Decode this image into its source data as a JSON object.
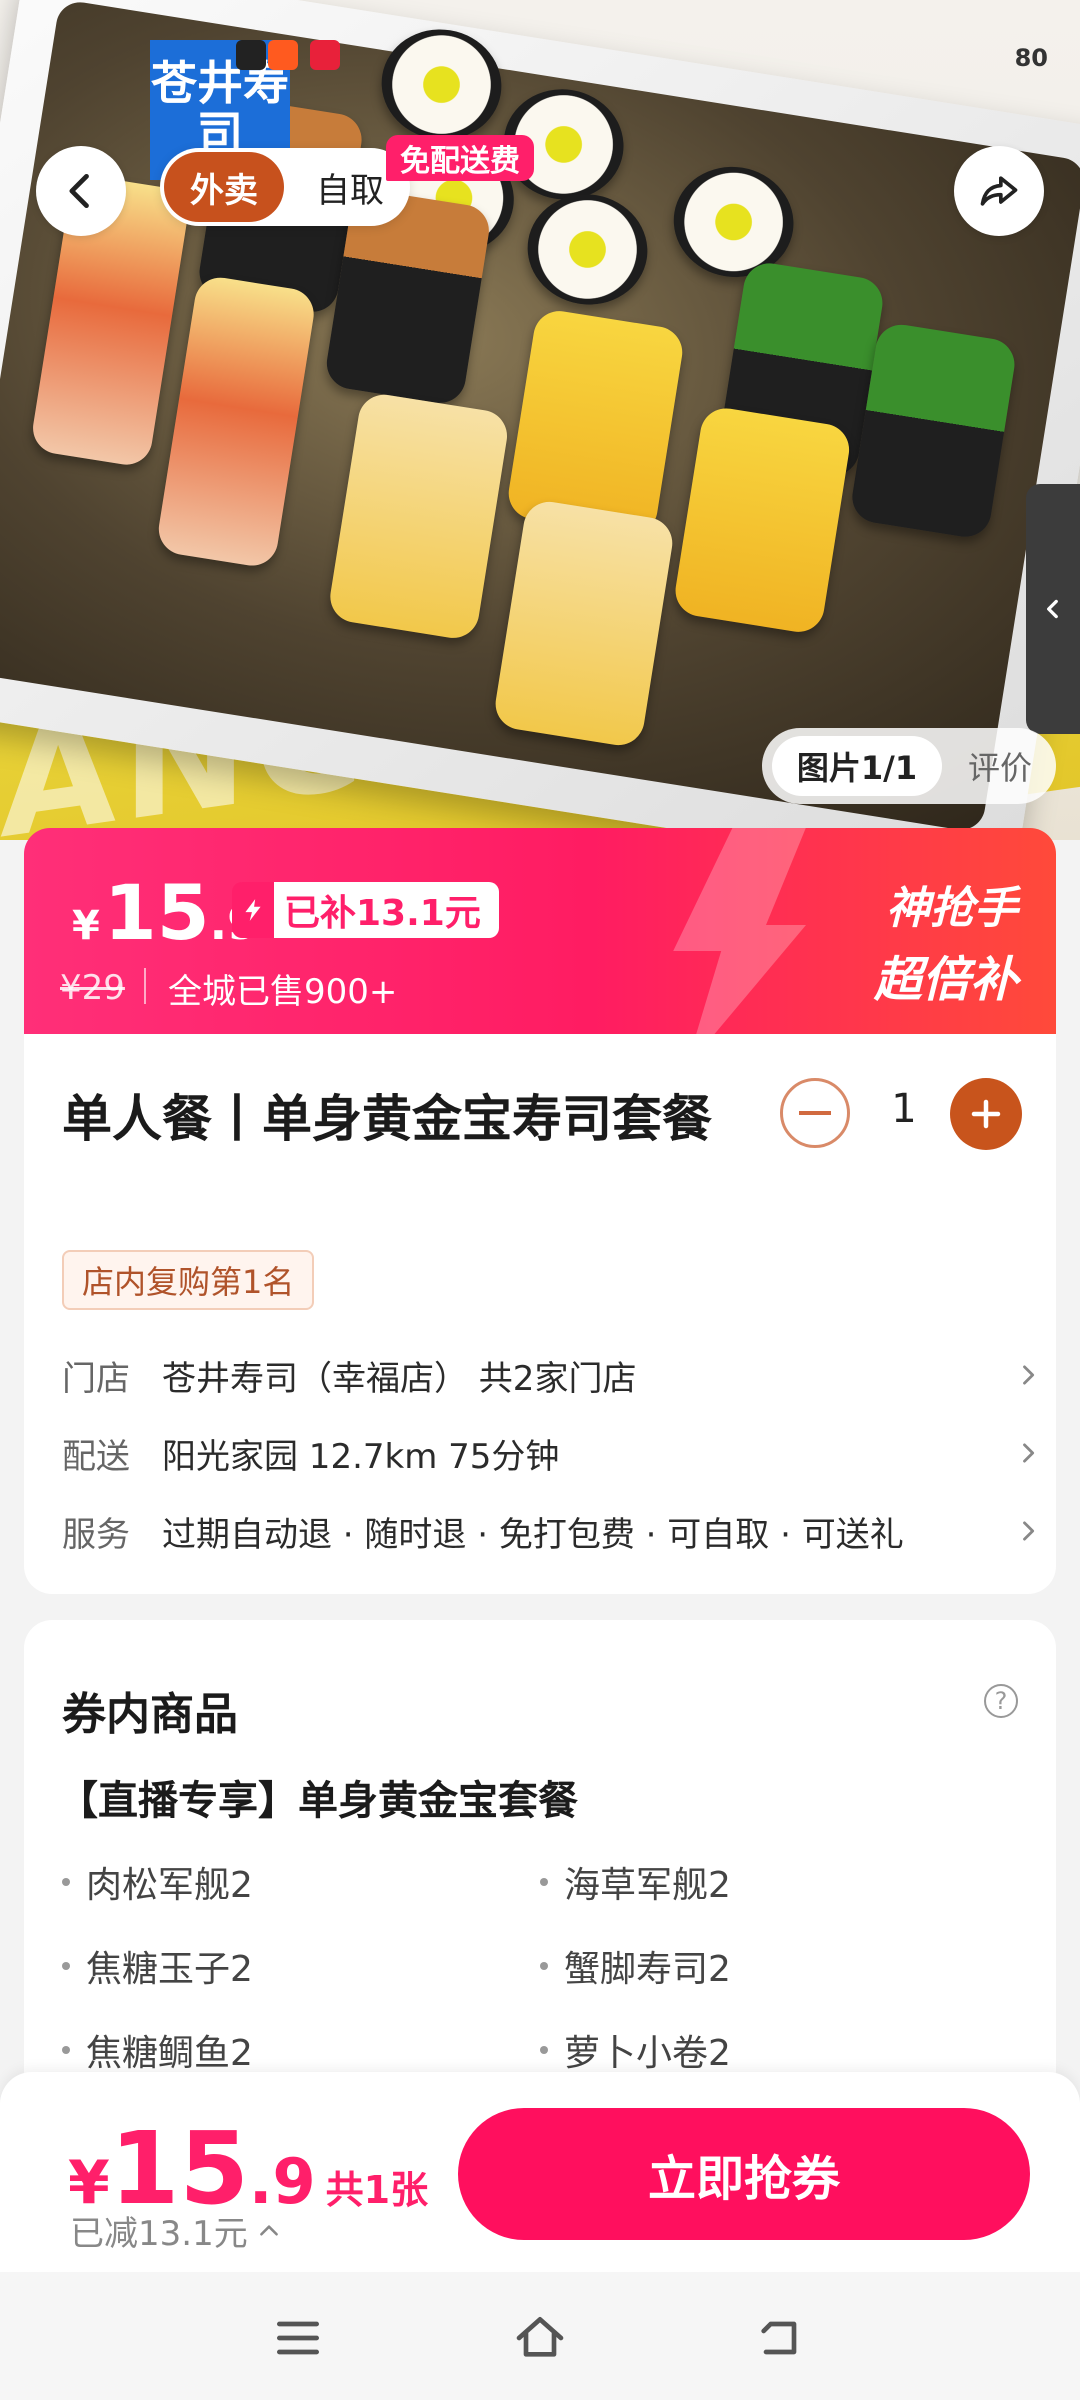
{
  "status": {
    "battery": "80"
  },
  "hero": {
    "logo_text": "苍井寿司",
    "mode_active": "外卖",
    "mode_inactive": "自取",
    "free_delivery_badge": "免配送费",
    "image_tab_active": "图片1/1",
    "image_tab_review": "评价"
  },
  "promo": {
    "currency": "¥",
    "price_int": "15",
    "price_dec": ".9",
    "subsidy": "已补13.1元",
    "original_price": "¥29",
    "sold": "全城已售900+",
    "badge_line1": "神抢手",
    "badge_line2": "超倍补"
  },
  "product": {
    "title": "单人餐丨单身黄金宝寿司套餐",
    "quantity": "1",
    "rank_tag": "店内复购第1名",
    "rows": [
      {
        "label": "门店",
        "value": "苍井寿司（幸福店） 共2家门店"
      },
      {
        "label": "配送",
        "value": "阳光家园  12.7km  75分钟"
      },
      {
        "label": "服务",
        "value": "过期自动退 · 随时退 · 免打包费 · 可自取 · 可送礼"
      }
    ]
  },
  "coupon_items": {
    "title": "券内商品",
    "set_name": "【直播专享】单身黄金宝套餐",
    "items": [
      "肉松军舰2",
      "海草军舰2",
      "焦糖玉子2",
      "蟹脚寿司2",
      "焦糖鲷鱼2",
      "萝卜小卷2"
    ]
  },
  "bottom_bar": {
    "currency": "¥",
    "price_int": "15",
    "price_dec": ".9",
    "count": "共1张",
    "reduced": "已减13.1元",
    "buy_label": "立即抢券"
  },
  "colors": {
    "accent_pink": "#ff1f6a",
    "accent_orange": "#c8541c"
  },
  "icons": [
    "back-icon",
    "share-icon",
    "chevron-left-icon",
    "minus-icon",
    "plus-icon",
    "chevron-right-icon",
    "help-icon",
    "chevron-up-icon",
    "menu-icon",
    "home-icon",
    "return-icon"
  ]
}
